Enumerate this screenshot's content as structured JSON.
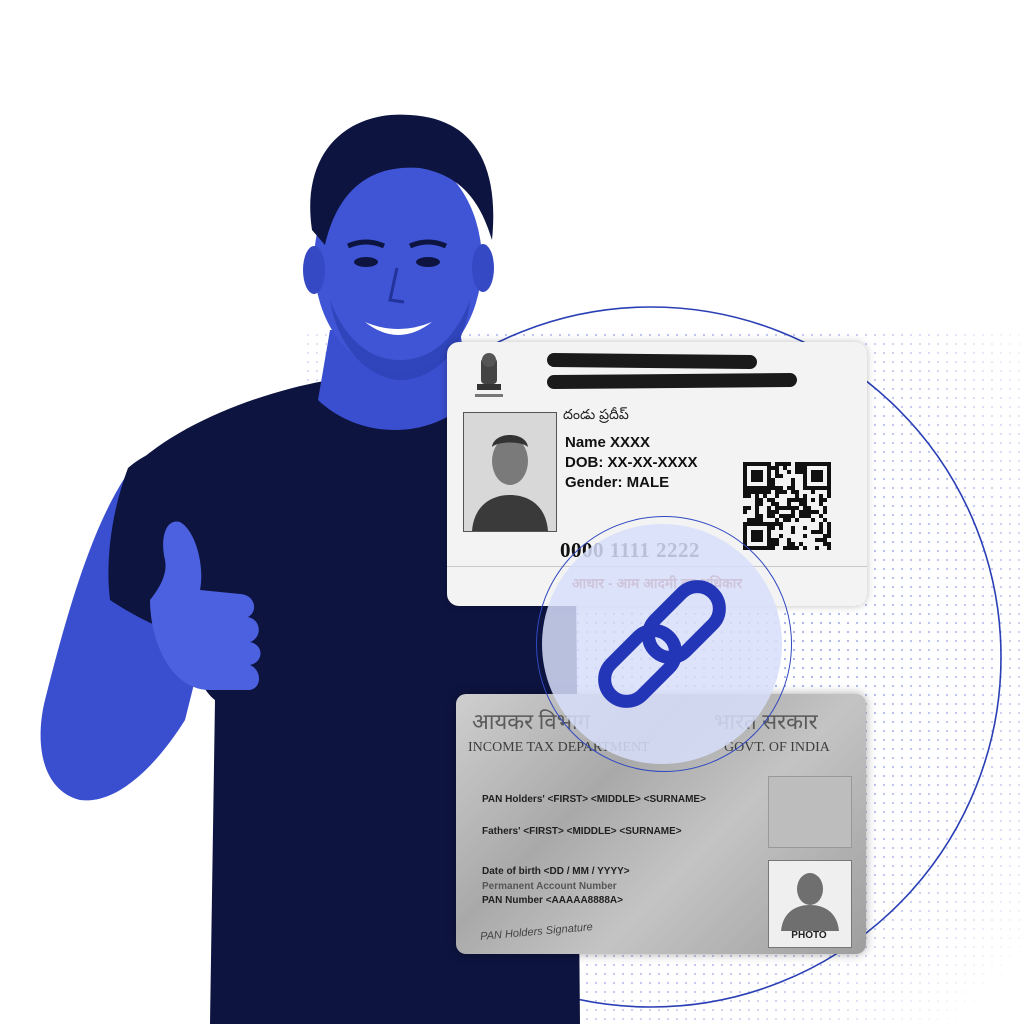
{
  "colors": {
    "brand_blue": "#3a4fcf",
    "dark_navy": "#0d1440",
    "ring_blue": "#2a3fb5"
  },
  "aadhaar_card": {
    "telugu_name": "దండు ప్రదీప్",
    "name_line": "Name XXXX",
    "dob_line": "DOB: XX-XX-XXXX",
    "gender_line": "Gender: MALE",
    "aadhaar_number": "0000 1111 2222",
    "tagline": "आधार - आम आदमी का अधिकार"
  },
  "pan_card": {
    "header_hindi_1": "आयकर विभाग",
    "header_hindi_2": "भारत सरकार",
    "dept_left": "INCOME TAX DEPARTMENT",
    "dept_right": "GOVT. OF INDIA",
    "holder_field": "PAN Holders' <FIRST> <MIDDLE> <SURNAME>",
    "father_field": "Fathers' <FIRST> <MIDDLE> <SURNAME>",
    "dob_field": "Date of birth <DD / MM / YYYY>",
    "account_label": "Permanent Account Number",
    "pan_number_field": "PAN Number <AAAAA8888A>",
    "signature_label": "PAN Holders Signature",
    "photo_label": "PHOTO"
  },
  "link_badge": {
    "icon": "chain-link-icon"
  }
}
